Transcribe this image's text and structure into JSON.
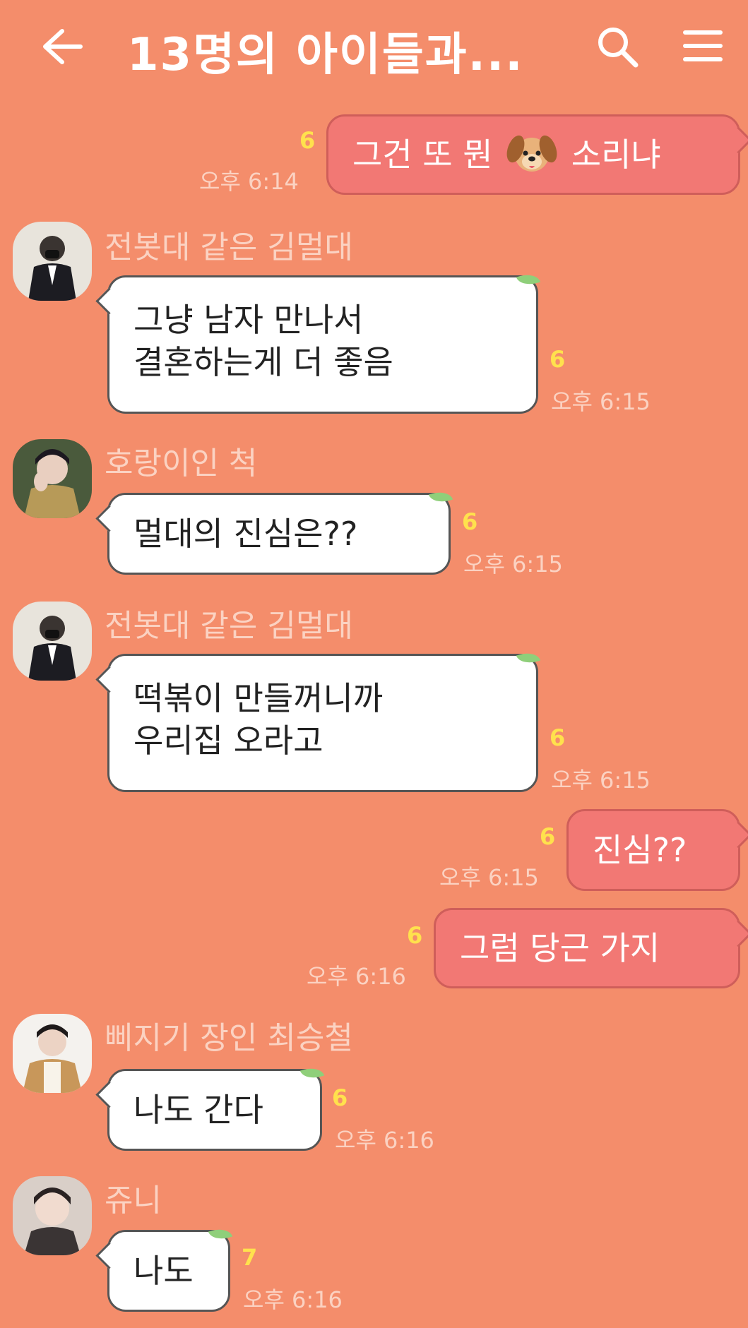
{
  "header": {
    "title": "13명의 아이들과...",
    "back_icon": "arrow-left-icon",
    "search_icon": "search-icon",
    "menu_icon": "hamburger-menu-icon"
  },
  "colors": {
    "background": "#f48d6b",
    "outgoing_bubble": "#f27874",
    "incoming_bubble": "#ffffff",
    "unread_count": "#ffe14d"
  },
  "messages": [
    {
      "direction": "out",
      "text_before": "그건 또 뭔",
      "emoji": "dog-face",
      "text_after": "소리냐",
      "unread": "6",
      "time": "오후 6:14"
    },
    {
      "direction": "in",
      "sender": "전봇대 같은 김멀대",
      "lines": [
        "그냥 남자 만나서",
        "결혼하는게 더 좋음"
      ],
      "unread": "6",
      "time": "오후 6:15"
    },
    {
      "direction": "in",
      "sender": "호랑이인 척",
      "lines": [
        "멀대의 진심은??"
      ],
      "unread": "6",
      "time": "오후 6:15"
    },
    {
      "direction": "in",
      "sender": "전봇대 같은 김멀대",
      "lines": [
        "떡볶이 만들꺼니까",
        "우리집 오라고"
      ],
      "unread": "6",
      "time": "오후 6:15"
    },
    {
      "direction": "out",
      "text": "진심??",
      "unread": "6",
      "time": "오후 6:15"
    },
    {
      "direction": "out",
      "text": "그럼 당근 가지",
      "unread": "6",
      "time": "오후 6:16"
    },
    {
      "direction": "in",
      "sender": "삐지기 장인 최승철",
      "lines": [
        "나도 간다"
      ],
      "unread": "6",
      "time": "오후 6:16"
    },
    {
      "direction": "in",
      "sender": "쥬니",
      "lines": [
        "나도"
      ],
      "unread": "7",
      "time": "오후 6:16"
    }
  ]
}
